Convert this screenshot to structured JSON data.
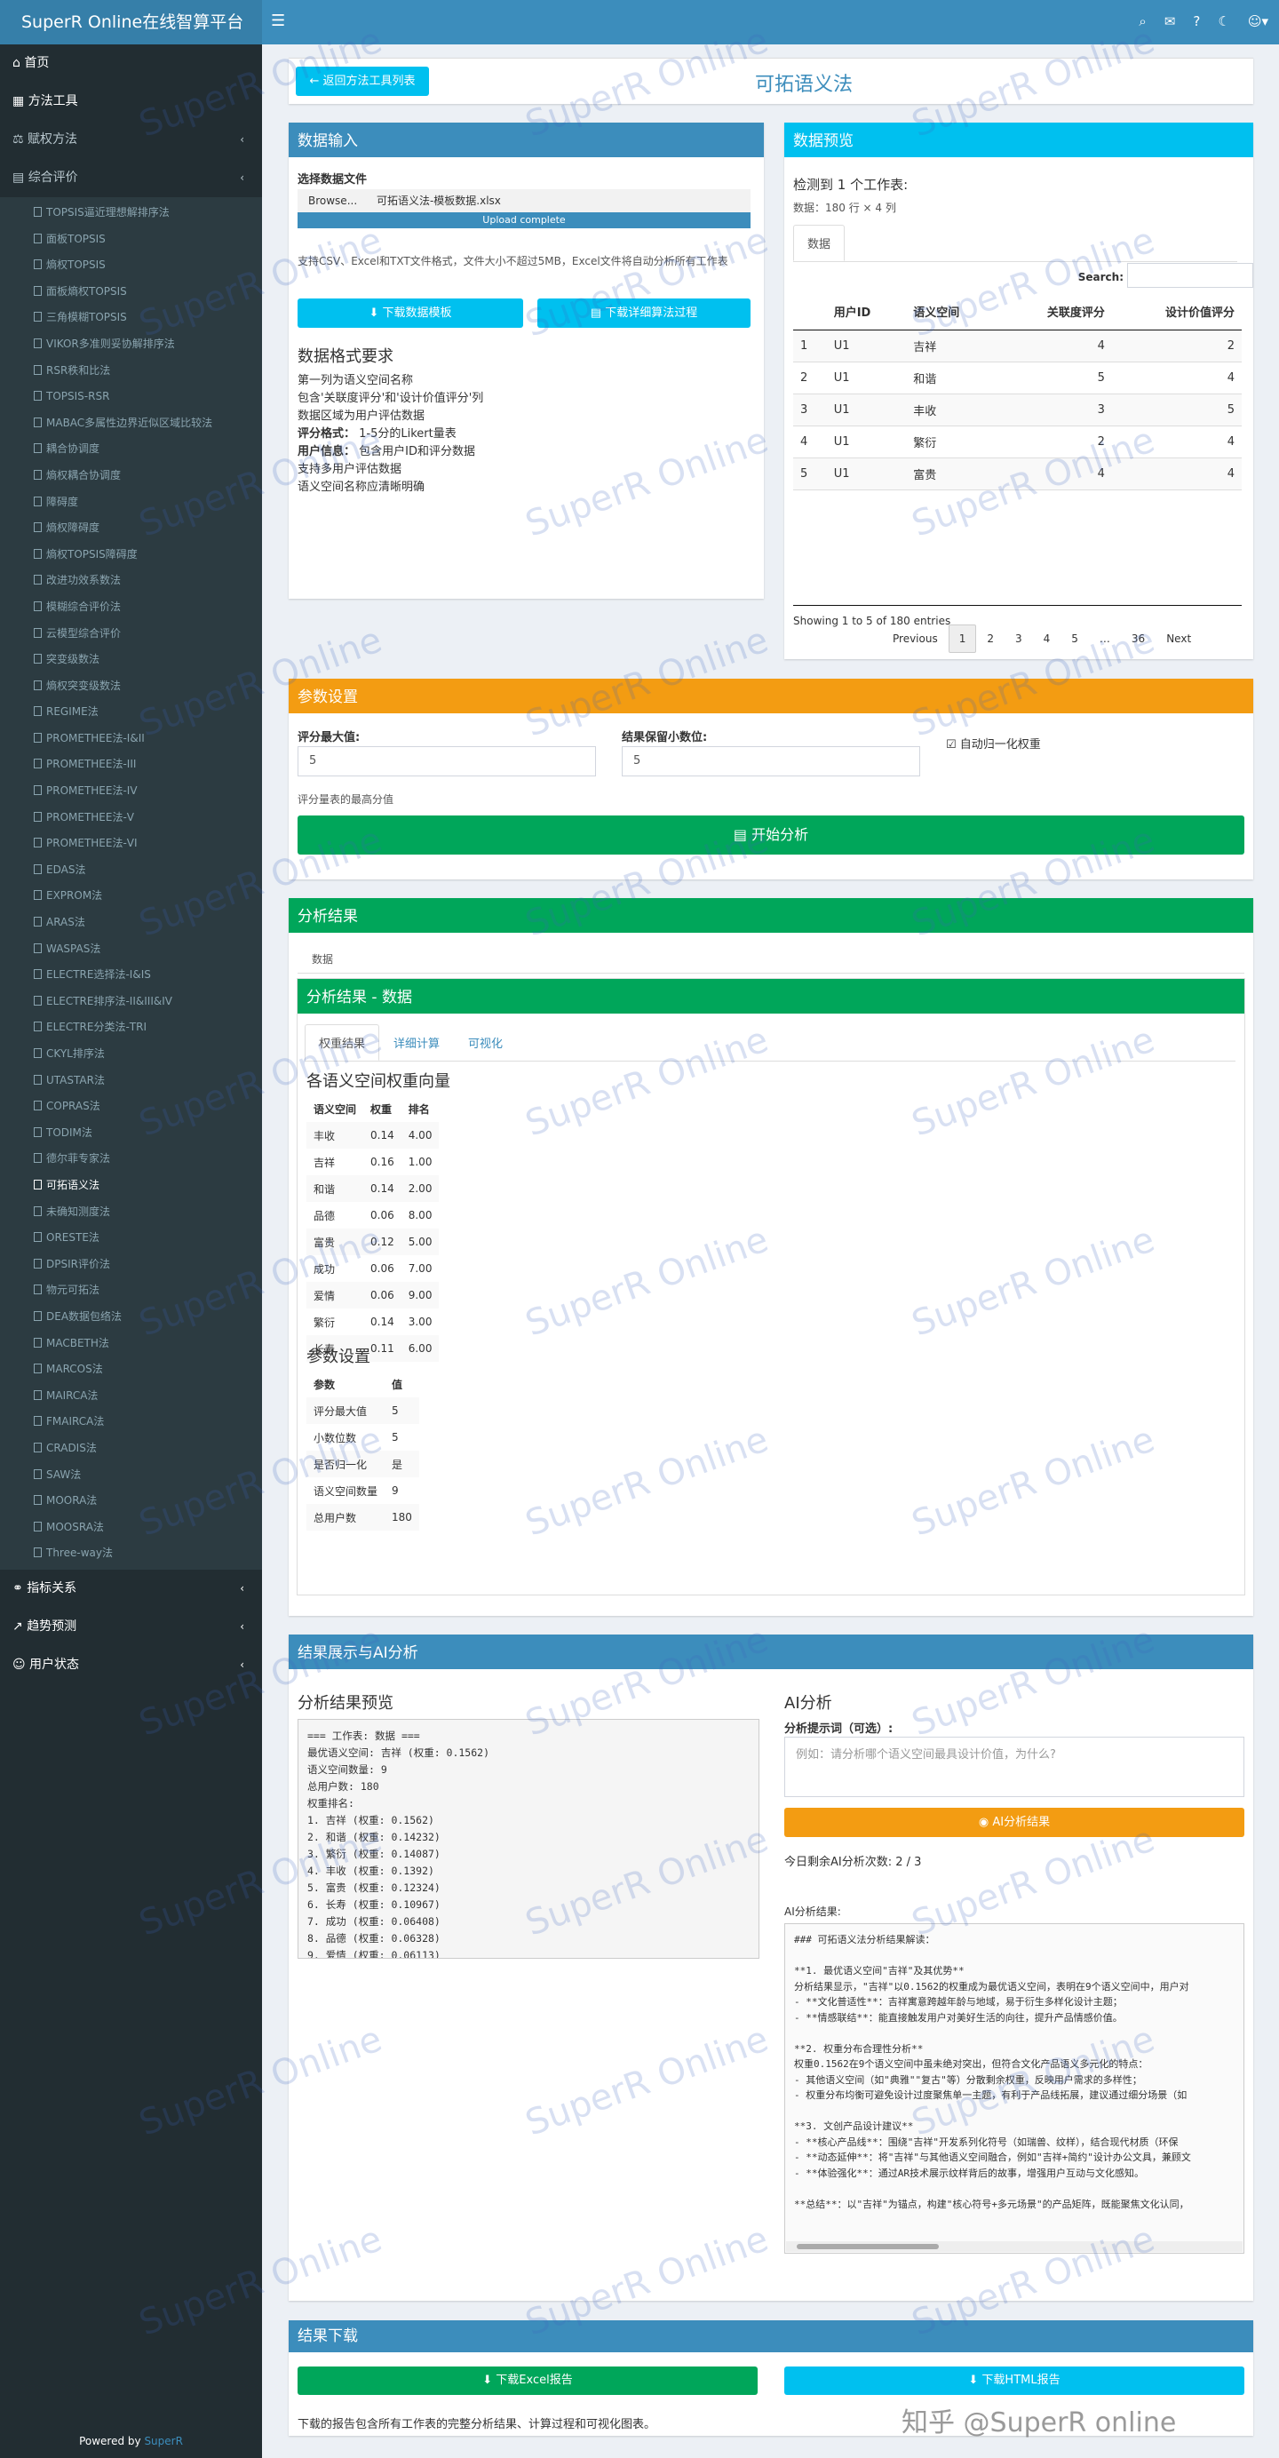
{
  "app": {
    "logo": "SuperR Online在线智算平台",
    "powered_prefix": "Powered by ",
    "powered_brand": "SuperR"
  },
  "sidebar": {
    "top_items": [
      {
        "label": "首页",
        "icon": "home-icon"
      },
      {
        "label": "方法工具",
        "icon": "table-icon"
      },
      {
        "label": "赋权方法",
        "icon": "balance-icon"
      },
      {
        "label": "综合评价",
        "icon": "chart-icon"
      }
    ],
    "sub_items": [
      "TOPSIS逼近理想解排序法",
      "面板TOPSIS",
      "熵权TOPSIS",
      "面板熵权TOPSIS",
      "三角模糊TOPSIS",
      "VIKOR多准则妥协解排序法",
      "RSR秩和比法",
      "TOPSIS-RSR",
      "MABAC多属性边界近似区域比较法",
      "耦合协调度",
      "熵权耦合协调度",
      "障碍度",
      "熵权障碍度",
      "熵权TOPSIS障碍度",
      "改进功效系数法",
      "模糊综合评价法",
      "云模型综合评价",
      "突变级数法",
      "熵权突变级数法",
      "REGIME法",
      "PROMETHEE法-I&II",
      "PROMETHEE法-III",
      "PROMETHEE法-IV",
      "PROMETHEE法-V",
      "PROMETHEE法-VI",
      "EDAS法",
      "EXPROM法",
      "ARAS法",
      "WASPAS法",
      "ELECTRE选择法-I&IS",
      "ELECTRE排序法-II&III&IV",
      "ELECTRE分类法-TRI",
      "CKYL排序法",
      "UTASTAR法",
      "COPRAS法",
      "TODIM法",
      "德尔菲专家法",
      "可拓语义法",
      "未确知测度法",
      "ORESTE法",
      "DPSIR评价法",
      "物元可拓法",
      "DEA数据包络法",
      "MACBETH法",
      "MARCOS法",
      "MAIRCA法",
      "FMAIRCA法",
      "CRADIS法",
      "SAW法",
      "MOORA法",
      "MOOSRA法",
      "Three-way法"
    ],
    "active_index": 37,
    "bottom_items": [
      {
        "label": "指标关系",
        "icon": "link-icon"
      },
      {
        "label": "趋势预测",
        "icon": "trend-icon"
      },
      {
        "label": "用户状态",
        "icon": "user-icon"
      }
    ]
  },
  "header": {
    "back_button": "返回方法工具列表",
    "title": "可拓语义法"
  },
  "data_input": {
    "title": "数据输入",
    "file_label": "选择数据文件",
    "browse": "Browse...",
    "file_name": "可拓语义法-模板数据.xlsx",
    "upload_status": "Upload complete",
    "support_text": "支持CSV、Excel和TXT文件格式，文件大小不超过5MB，Excel文件将自动分析所有工作表",
    "download_template": "下载数据模板",
    "download_algorithm": "下载详细算法过程",
    "format_title": "数据格式要求",
    "format_lines": [
      "第一列为语义空间名称",
      "包含'关联度评分'和'设计价值评分'列",
      "数据区域为用户评估数据"
    ],
    "score_label": "评分格式：",
    "score_value": "1-5分的Likert量表",
    "user_label": "用户信息：",
    "user_value": "包含用户ID和评分数据",
    "format_lines2": [
      "支持多用户评估数据",
      "语义空间名称应清晰明确"
    ]
  },
  "preview": {
    "title": "数据预览",
    "detected": "检测到 1 个工作表:",
    "stats": "数据：180 行 × 4 列",
    "tab": "数据",
    "search_label": "Search:",
    "columns": [
      "",
      "用户ID",
      "语义空间",
      "关联度评分",
      "设计价值评分"
    ],
    "rows": [
      [
        "1",
        "U1",
        "吉祥",
        "4",
        "2"
      ],
      [
        "2",
        "U1",
        "和谐",
        "5",
        "4"
      ],
      [
        "3",
        "U1",
        "丰收",
        "3",
        "5"
      ],
      [
        "4",
        "U1",
        "繁衍",
        "2",
        "4"
      ],
      [
        "5",
        "U1",
        "富贵",
        "4",
        "4"
      ]
    ],
    "info": "Showing 1 to 5 of 180 entries",
    "pager": [
      "Previous",
      "1",
      "2",
      "3",
      "4",
      "5",
      "…",
      "36",
      "Next"
    ]
  },
  "params": {
    "title": "参数设置",
    "max_label": "评分最大值:",
    "max_value": "5",
    "max_help": "评分量表的最高分值",
    "decimal_label": "结果保留小数位:",
    "decimal_value": "5",
    "normalize_label": "自动归一化权重",
    "start_button": "开始分析"
  },
  "results": {
    "title": "分析结果",
    "tab": "数据",
    "inner_title": "分析结果 - 数据",
    "inner_tabs": [
      "权重结果",
      "详细计算",
      "可视化"
    ],
    "weights_title": "各语义空间权重向量",
    "weights_columns": [
      "语义空间",
      "权重",
      "排名"
    ],
    "weights_rows": [
      [
        "丰收",
        "0.14",
        "4.00"
      ],
      [
        "吉祥",
        "0.16",
        "1.00"
      ],
      [
        "和谐",
        "0.14",
        "2.00"
      ],
      [
        "品德",
        "0.06",
        "8.00"
      ],
      [
        "富贵",
        "0.12",
        "5.00"
      ],
      [
        "成功",
        "0.06",
        "7.00"
      ],
      [
        "爱情",
        "0.06",
        "9.00"
      ],
      [
        "繁衍",
        "0.14",
        "3.00"
      ],
      [
        "长寿",
        "0.11",
        "6.00"
      ]
    ],
    "params_title": "参数设置",
    "params_columns": [
      "参数",
      "值"
    ],
    "params_rows": [
      [
        "评分最大值",
        "5"
      ],
      [
        "小数位数",
        "5"
      ],
      [
        "是否归一化",
        "是"
      ],
      [
        "语义空间数量",
        "9"
      ],
      [
        "总用户数",
        "180"
      ]
    ]
  },
  "display": {
    "title": "结果展示与AI分析",
    "preview_title": "分析结果预览",
    "preview_text": "=== 工作表: 数据 ===\n最优语义空间: 吉祥 (权重: 0.1562)\n语义空间数量: 9\n总用户数: 180\n权重排名:\n1. 吉祥 (权重: 0.1562)\n2. 和谐 (权重: 0.14232)\n3. 繁衍 (权重: 0.14087)\n4. 丰收 (权重: 0.1392)\n5. 富贵 (权重: 0.12324)\n6. 长寿 (权重: 0.10967)\n7. 成功 (权重: 0.06408)\n8. 品德 (权重: 0.06328)\n9. 爱情 (权重: 0.06113)",
    "ai_title": "AI分析",
    "prompt_label": "分析提示词（可选）:",
    "prompt_placeholder": "例如：请分析哪个语义空间最具设计价值，为什么?",
    "ai_button": "AI分析结果",
    "remaining": "今日剩余AI分析次数: 2 / 3",
    "ai_result_label": "AI分析结果:",
    "ai_text": "### 可拓语义法分析结果解读：\n\n**1. 最优语义空间\"吉祥\"及其优势**\n分析结果显示，\"吉祥\"以0.1562的权重成为最优语义空间，表明在9个语义空间中，用户对\n- **文化普适性**：吉祥寓意跨越年龄与地域，易于衍生多样化设计主题；\n- **情感联结**：能直接触发用户对美好生活的向往，提升产品情感价值。\n\n**2. 权重分布合理性分析**\n权重0.1562在9个语义空间中虽未绝对突出，但符合文化产品语义多元化的特点：\n- 其他语义空间（如\"典雅\"\"复古\"等）分散剩余权重，反映用户需求的多样性；\n- 权重分布均衡可避免设计过度聚焦单一主题，有利于产品线拓展，建议通过细分场景（如\n\n**3. 文创产品设计建议**\n- **核心产品线**：围绕\"吉祥\"开发系列化符号（如瑞兽、纹样），结合现代材质（环保\n- **动态延伸**：将\"吉祥\"与其他语义空间融合，例如\"吉祥+简约\"设计办公文具，兼顾文\n- **体验强化**：通过AR技术展示纹样背后的故事，增强用户互动与文化感知。\n\n**总结**：以\"吉祥\"为锚点，构建\"核心符号+多元场景\"的产品矩阵，既能聚焦文化认同，"
  },
  "download": {
    "title": "结果下载",
    "excel_button": "下载Excel报告",
    "html_button": "下载HTML报告",
    "note": "下载的报告包含所有工作表的完整分析结果、计算过程和可视化图表。",
    "zhihu": "知乎 @SuperR online"
  },
  "watermark": "SuperR Online",
  "colors": {
    "primary": "#3c8dbc",
    "info": "#00c0ef",
    "warning": "#f39c12",
    "success": "#00a65a",
    "sidebar": "#222d32"
  }
}
